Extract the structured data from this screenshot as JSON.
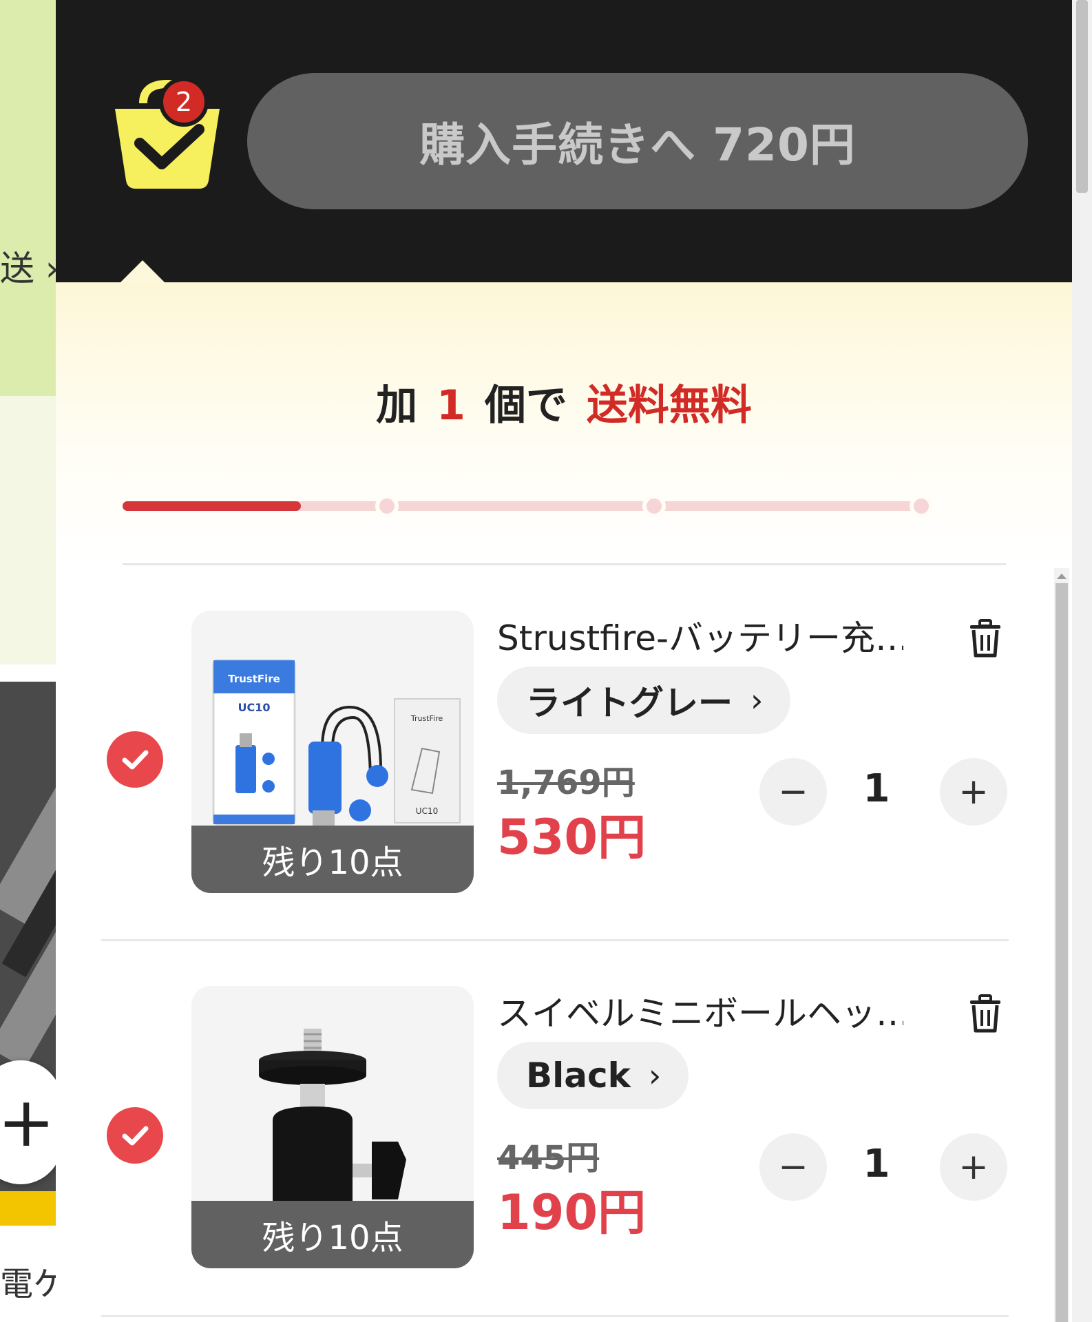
{
  "background_page": {
    "side_text": "送 ›",
    "bottom_text": "電ケー",
    "add_button": "+"
  },
  "cart": {
    "badge_count": "2",
    "checkout_label": "購入手続きへ 720円",
    "shipping": {
      "prefix": "加",
      "count": "1",
      "middle": "個で",
      "highlight": "送料無料",
      "progress_fraction": 0.2
    },
    "items": [
      {
        "title": "Strustfire-バッテリー充…",
        "variant": "ライトグレー",
        "original_price": "1,769円",
        "sale_price": "530円",
        "quantity": "1",
        "stock_label": "残り10点",
        "minus": "−",
        "plus": "+"
      },
      {
        "title": "スイベルミニボールヘッ…",
        "variant": "Black",
        "original_price": "445円",
        "sale_price": "190円",
        "quantity": "1",
        "stock_label": "残り10点",
        "minus": "−",
        "plus": "+"
      }
    ],
    "thumb_labels": {
      "brand": "TrustFire",
      "model": "UC10"
    }
  },
  "colors": {
    "header_bg": "#1c1b1b",
    "accent_red": "#d22a25",
    "price_red": "#e0414a",
    "cart_yellow": "#f7f05e"
  },
  "icons": {
    "cart": "shopping-bag-check-icon",
    "check": "check-circle-icon",
    "trash": "trash-icon",
    "chevron": "chevron-right-icon"
  }
}
